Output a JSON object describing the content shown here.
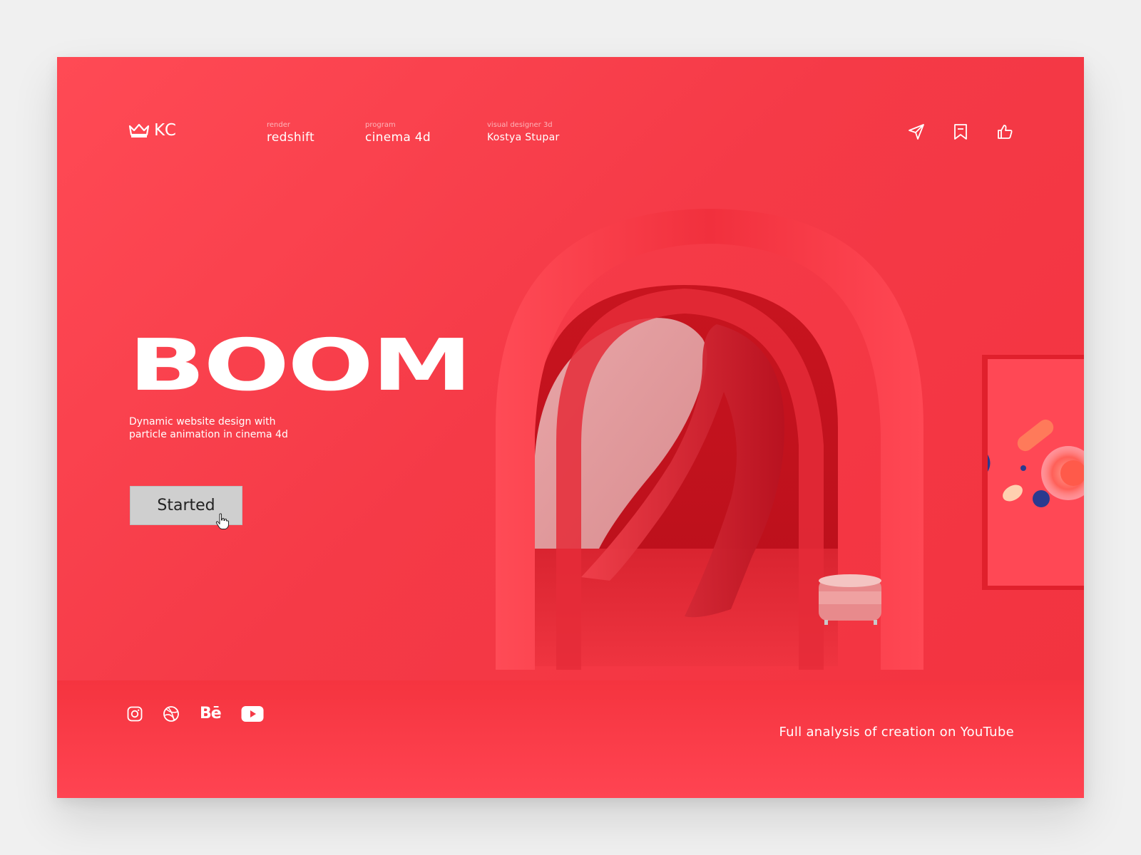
{
  "brand": {
    "logo_icon": "crown-icon",
    "logo_text": "KC"
  },
  "meta": [
    {
      "label": "render",
      "value": "redshift"
    },
    {
      "label": "program",
      "value": "cinema 4d"
    },
    {
      "label": "visual designer 3d",
      "value": "Kostya Stupar"
    }
  ],
  "actions": [
    "send-icon",
    "bookmark-icon",
    "thumbs-up-icon"
  ],
  "hero": {
    "title": "BOOM",
    "subtitle_line1": "Dynamic website design with",
    "subtitle_line2": "particle animation in cinema 4d",
    "cta_label": "Started"
  },
  "social": [
    "instagram-icon",
    "dribbble-icon",
    "behance-icon",
    "youtube-icon"
  ],
  "social_behance_text": "Bē",
  "footer": {
    "link_text": "Full analysis of creation on YouTube"
  },
  "colors": {
    "background": "#f0f0f0",
    "accent": "#f53a47",
    "text": "#ffffff",
    "button": "#cfcfcf"
  }
}
